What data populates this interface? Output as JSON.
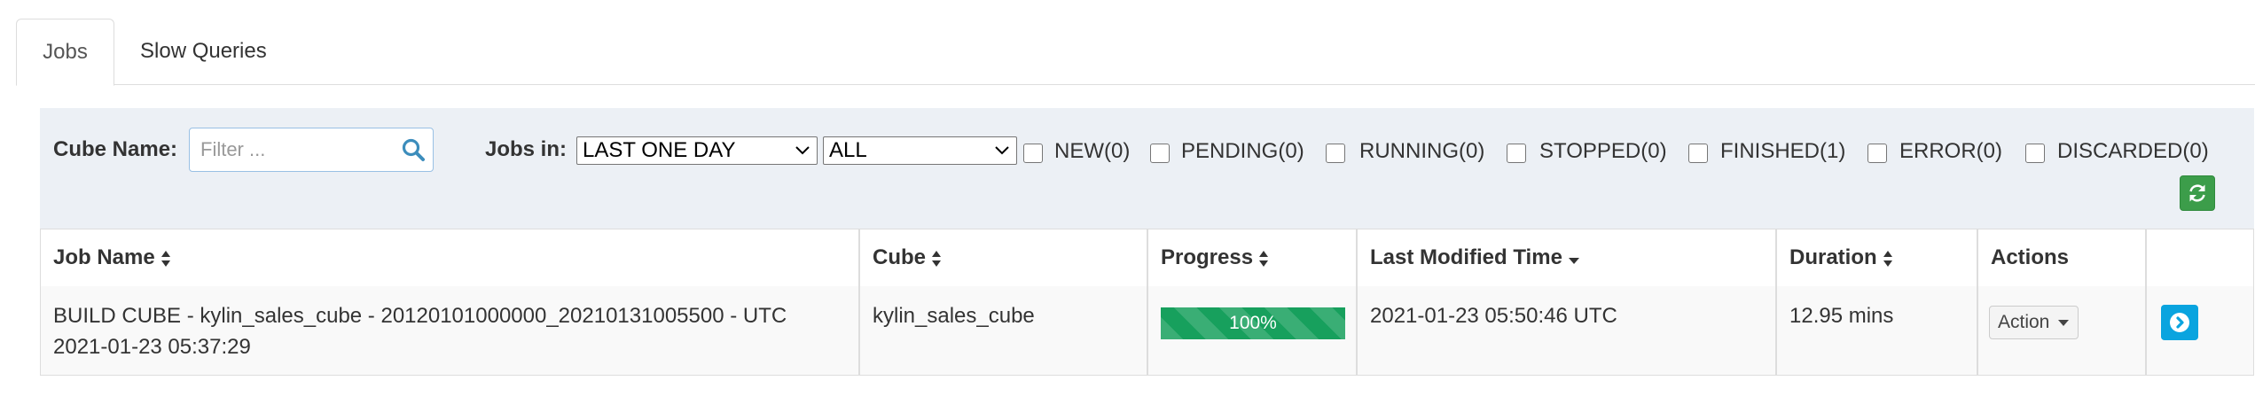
{
  "tabs": [
    {
      "label": "Jobs",
      "active": true
    },
    {
      "label": "Slow Queries",
      "active": false
    }
  ],
  "filter": {
    "cube_name_label": "Cube Name:",
    "cube_name_placeholder": "Filter ...",
    "jobs_in_label": "Jobs in:",
    "time_range_selected": "LAST ONE DAY",
    "scope_selected": "ALL",
    "statuses": [
      {
        "label": "NEW(0)",
        "checked": false
      },
      {
        "label": "PENDING(0)",
        "checked": false
      },
      {
        "label": "RUNNING(0)",
        "checked": false
      },
      {
        "label": "STOPPED(0)",
        "checked": false
      },
      {
        "label": "FINISHED(1)",
        "checked": false
      },
      {
        "label": "ERROR(0)",
        "checked": false
      },
      {
        "label": "DISCARDED(0)",
        "checked": false
      }
    ]
  },
  "table": {
    "columns": [
      "Job Name",
      "Cube",
      "Progress",
      "Last Modified Time",
      "Duration",
      "Actions"
    ],
    "rows": [
      {
        "job_name_line1": "BUILD CUBE - kylin_sales_cube - 20120101000000_20210131005500 - UTC",
        "job_name_line2": "2021-01-23 05:37:29",
        "cube": "kylin_sales_cube",
        "progress_label": "100%",
        "progress": 1.0,
        "last_modified": "2021-01-23 05:50:46 UTC",
        "duration": "12.95 mins",
        "action_label": "Action"
      }
    ]
  },
  "colors": {
    "panel_bg": "#ecf0f5",
    "progress": "#17a05d",
    "refresh": "#3c9d4a",
    "detail": "#0aa4df"
  },
  "icons": {
    "search": "search-icon",
    "refresh": "refresh-icon",
    "detail": "chevron-circle-right-icon",
    "sort": "sort-icon",
    "sort_desc": "sort-down-icon"
  }
}
